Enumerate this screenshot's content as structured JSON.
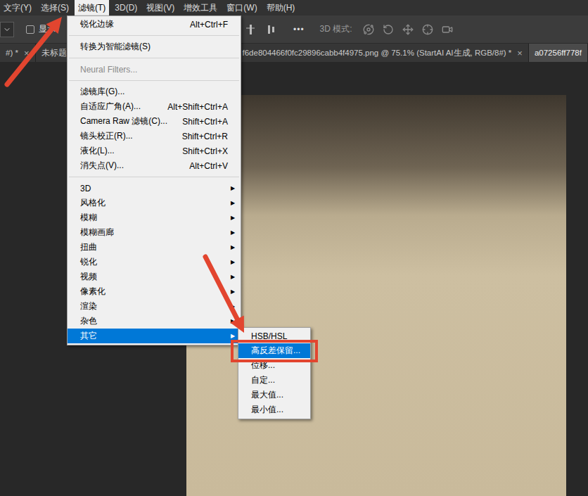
{
  "menubar": [
    {
      "label": "文字(Y)",
      "selected": false
    },
    {
      "label": "选择(S)",
      "selected": false
    },
    {
      "label": "滤镜(T)",
      "selected": true
    },
    {
      "label": "3D(D)",
      "selected": false
    },
    {
      "label": "视图(V)",
      "selected": false
    },
    {
      "label": "增效工具",
      "selected": false
    },
    {
      "label": "窗口(W)",
      "selected": false
    },
    {
      "label": "帮助(H)",
      "selected": false
    }
  ],
  "options_bar": {
    "checkbox": {
      "label": "显示",
      "checked": false
    },
    "more": "•••",
    "mode_label": "3D 模式:"
  },
  "tabs": [
    {
      "label": "#) *",
      "close": "×",
      "selected": false
    },
    {
      "label": "未标题-",
      "close": "",
      "selected": false
    },
    {
      "label": "f6de804466f0fc29896cabb4f4975.png @ 75.1% (StartAI AI生成, RGB/8#) *",
      "close": "×",
      "selected": false
    },
    {
      "label": "a07256ff778f",
      "close": "",
      "selected": true
    }
  ],
  "filter_menu": {
    "items": [
      {
        "kind": "item",
        "label": "锐化边缘",
        "shortcut": "Alt+Ctrl+F",
        "disabled": false,
        "selected": false
      },
      {
        "kind": "separator"
      },
      {
        "kind": "item",
        "label": "转换为智能滤镜(S)",
        "shortcut": "",
        "disabled": false,
        "selected": false
      },
      {
        "kind": "separator"
      },
      {
        "kind": "item",
        "label": "Neural Filters...",
        "shortcut": "",
        "disabled": true,
        "selected": false
      },
      {
        "kind": "separator"
      },
      {
        "kind": "item",
        "label": "滤镜库(G)...",
        "shortcut": "",
        "disabled": false,
        "selected": false
      },
      {
        "kind": "item",
        "label": "自适应广角(A)...",
        "shortcut": "Alt+Shift+Ctrl+A",
        "disabled": false,
        "selected": false
      },
      {
        "kind": "item",
        "label": "Camera Raw 滤镜(C)...",
        "shortcut": "Shift+Ctrl+A",
        "disabled": false,
        "selected": false
      },
      {
        "kind": "item",
        "label": "镜头校正(R)...",
        "shortcut": "Shift+Ctrl+R",
        "disabled": false,
        "selected": false
      },
      {
        "kind": "item",
        "label": "液化(L)...",
        "shortcut": "Shift+Ctrl+X",
        "disabled": false,
        "selected": false
      },
      {
        "kind": "item",
        "label": "消失点(V)...",
        "shortcut": "Alt+Ctrl+V",
        "disabled": false,
        "selected": false
      },
      {
        "kind": "separator"
      },
      {
        "kind": "submenu",
        "label": "3D",
        "arrow": "▶",
        "selected": false
      },
      {
        "kind": "submenu",
        "label": "风格化",
        "arrow": "▶",
        "selected": false
      },
      {
        "kind": "submenu",
        "label": "模糊",
        "arrow": "▶",
        "selected": false
      },
      {
        "kind": "submenu",
        "label": "模糊画廊",
        "arrow": "▶",
        "selected": false
      },
      {
        "kind": "submenu",
        "label": "扭曲",
        "arrow": "▶",
        "selected": false
      },
      {
        "kind": "submenu",
        "label": "锐化",
        "arrow": "▶",
        "selected": false
      },
      {
        "kind": "submenu",
        "label": "视频",
        "arrow": "▶",
        "selected": false
      },
      {
        "kind": "submenu",
        "label": "像素化",
        "arrow": "▶",
        "selected": false
      },
      {
        "kind": "submenu",
        "label": "渲染",
        "arrow": "▶",
        "selected": false
      },
      {
        "kind": "submenu",
        "label": "杂色",
        "arrow": "▶",
        "selected": false
      },
      {
        "kind": "submenu",
        "label": "其它",
        "arrow": "▶",
        "selected": true
      }
    ]
  },
  "other_submenu": {
    "items": [
      {
        "label": "HSB/HSL",
        "selected": false
      },
      {
        "label": "高反差保留...",
        "selected": true
      },
      {
        "label": "位移...",
        "selected": false
      },
      {
        "label": "自定...",
        "selected": false
      },
      {
        "label": "最大值...",
        "selected": false
      },
      {
        "label": "最小值...",
        "selected": false
      }
    ]
  }
}
